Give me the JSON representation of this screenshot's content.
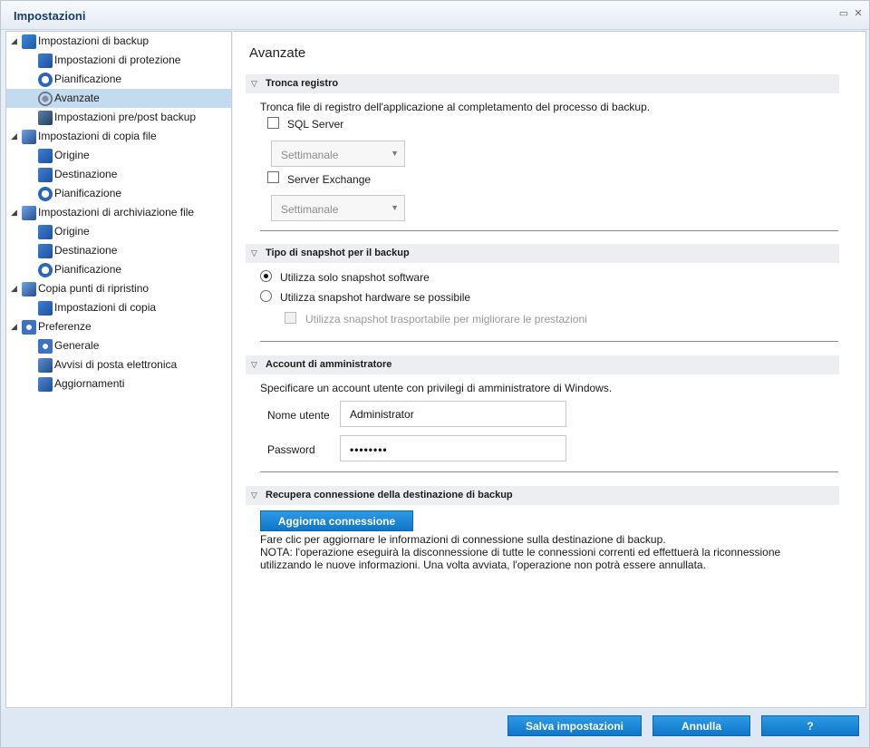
{
  "window": {
    "title": "Impostazioni"
  },
  "sidebar": {
    "items": [
      {
        "label": "Impostazioni di backup",
        "icon": "backup-settings-icon",
        "level": 0,
        "expanded": true
      },
      {
        "label": "Impostazioni di protezione",
        "icon": "protection-icon",
        "level": 1
      },
      {
        "label": "Pianificazione",
        "icon": "schedule-icon",
        "level": 1
      },
      {
        "label": "Avanzate",
        "icon": "advanced-gear-icon",
        "level": 1,
        "selected": true
      },
      {
        "label": "Impostazioni pre/post backup",
        "icon": "wrench-icon",
        "level": 1
      },
      {
        "label": "Impostazioni di copia file",
        "icon": "file-copy-icon",
        "level": 0,
        "expanded": true
      },
      {
        "label": "Origine",
        "icon": "source-icon",
        "level": 1
      },
      {
        "label": "Destinazione",
        "icon": "destination-icon",
        "level": 1
      },
      {
        "label": "Pianificazione",
        "icon": "schedule-icon",
        "level": 1
      },
      {
        "label": "Impostazioni di archiviazione file",
        "icon": "file-archive-icon",
        "level": 0,
        "expanded": true
      },
      {
        "label": "Origine",
        "icon": "source-icon",
        "level": 1
      },
      {
        "label": "Destinazione",
        "icon": "destination-icon",
        "level": 1
      },
      {
        "label": "Pianificazione",
        "icon": "schedule-icon",
        "level": 1
      },
      {
        "label": "Copia punti di ripristino",
        "icon": "recovery-copy-icon",
        "level": 0,
        "expanded": true
      },
      {
        "label": "Impostazioni di copia",
        "icon": "copy-settings-icon",
        "level": 1
      },
      {
        "label": "Preferenze",
        "icon": "preferences-icon",
        "level": 0,
        "expanded": true
      },
      {
        "label": "Generale",
        "icon": "general-globe-icon",
        "level": 1
      },
      {
        "label": "Avvisi di posta elettronica",
        "icon": "email-icon",
        "level": 1
      },
      {
        "label": "Aggiornamenti",
        "icon": "updates-icon",
        "level": 1
      }
    ]
  },
  "main": {
    "title": "Avanzate",
    "truncate": {
      "header": "Tronca registro",
      "description": "Tronca file di registro dell'applicazione al completamento del processo di backup.",
      "sql_label": "SQL Server",
      "sql_frequency": "Settimanale",
      "exchange_label": "Server Exchange",
      "exchange_frequency": "Settimanale"
    },
    "snapshot": {
      "header": "Tipo di snapshot per il backup",
      "software_label": "Utilizza solo snapshot software",
      "hardware_label": "Utilizza snapshot hardware se possibile",
      "transportable_label": "Utilizza snapshot trasportabile per migliorare le prestazioni",
      "selected": "software"
    },
    "admin": {
      "header": "Account di amministratore",
      "description": "Specificare un account utente con privilegi di amministratore di Windows.",
      "username_label": "Nome utente",
      "username_value": "Administrator",
      "password_label": "Password",
      "password_value": "••••••••"
    },
    "reconnect": {
      "header": "Recupera connessione della destinazione di backup",
      "button_label": "Aggiorna connessione",
      "line1": "Fare clic per aggiornare le informazioni di connessione sulla destinazione di backup.",
      "line2": "NOTA: l'operazione eseguirà la disconnessione di tutte le connessioni correnti ed effettuerà la riconnessione",
      "line3": "utilizzando le nuove informazioni. Una volta avviata, l'operazione non potrà essere annullata."
    }
  },
  "footer": {
    "save_label": "Salva impostazioni",
    "cancel_label": "Annulla",
    "help_label": "?"
  },
  "colors": {
    "accent": "#1585d8",
    "selection": "#c2dbee",
    "section_bg": "#eceef1"
  }
}
